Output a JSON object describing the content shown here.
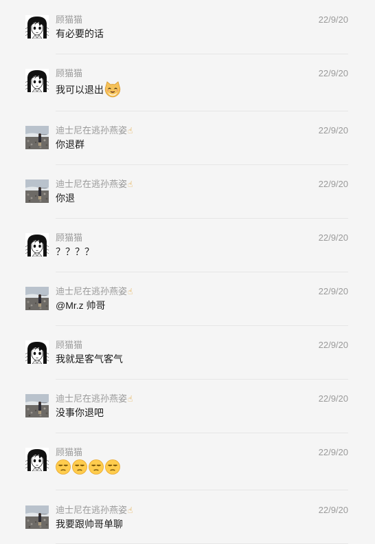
{
  "messages": [
    {
      "sender": "顾猫猫",
      "time": "22/9/20",
      "text": "有必要的话",
      "avatar": "anime-girl-avatar"
    },
    {
      "sender": "顾猫猫",
      "time": "22/9/20",
      "text": "我可以退出",
      "avatar": "anime-girl-avatar",
      "emoji": "cat-face-emoji"
    },
    {
      "sender": "迪士尼在逃孙燕姿",
      "time": "22/9/20",
      "text": "你退群",
      "avatar": "beach-photo-avatar"
    },
    {
      "sender": "迪士尼在逃孙燕姿",
      "time": "22/9/20",
      "text": "你退",
      "avatar": "beach-photo-avatar"
    },
    {
      "sender": "顾猫猫",
      "time": "22/9/20",
      "text": "？？？？",
      "avatar": "anime-girl-avatar"
    },
    {
      "sender": "迪士尼在逃孙燕姿",
      "time": "22/9/20",
      "text": "@Mr.z 帅哥",
      "avatar": "beach-photo-avatar"
    },
    {
      "sender": "顾猫猫",
      "time": "22/9/20",
      "text": "我就是客气客气",
      "avatar": "anime-girl-avatar"
    },
    {
      "sender": "迪士尼在逃孙燕姿",
      "time": "22/9/20",
      "text": "没事你退吧",
      "avatar": "beach-photo-avatar"
    },
    {
      "sender": "顾猫猫",
      "time": "22/9/20",
      "text": "",
      "avatar": "anime-girl-avatar",
      "emojis": [
        "unamused-face-emoji",
        "unamused-face-emoji",
        "unamused-face-emoji",
        "unamused-face-emoji"
      ]
    },
    {
      "sender": "迪士尼在逃孙燕姿",
      "time": "22/9/20",
      "text": "我要跟帅哥单聊",
      "avatar": "beach-photo-avatar"
    }
  ],
  "sender_suffix_icon": "pointing-finger-icon",
  "colors": {
    "background": "#f5f5f5",
    "meta_text": "#9a9a9a",
    "message_text": "#1a1a1a",
    "divider": "#e6e6e6"
  }
}
